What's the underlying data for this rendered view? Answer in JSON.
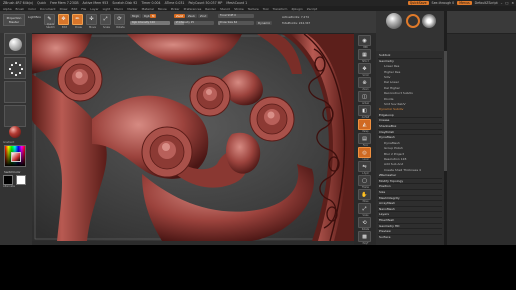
{
  "titlebar": {
    "segments": [
      "ZBrush 4R7 64b(x)",
      "Quick",
      "Free Mem 7.23GB",
      "Active Mem 953",
      "Scratch Disk 92",
      "Timer 0.004",
      "ATime 0.031",
      "PolyCount 50.037 MP",
      "MeshCount 1"
    ],
    "quicksave": "QuickSave",
    "see_through": "See-through 0",
    "menus": "Menus",
    "default_script": "DefaultZScript"
  },
  "menubar": {
    "items": [
      "Alpha",
      "Brush",
      "Color",
      "Document",
      "Draw",
      "Edit",
      "File",
      "Layer",
      "Light",
      "Macro",
      "Marker",
      "Material",
      "Movie",
      "Picker",
      "Preferences",
      "Render",
      "Stencil",
      "Stroke",
      "Texture",
      "Tool",
      "Transform",
      "Zplugin",
      "Zscript"
    ]
  },
  "shelf": {
    "projection_master": "Projection Master",
    "lightbox": "LightBox",
    "tools": [
      "Quick Sketch",
      "Edit",
      "Draw",
      "Move",
      "Scale",
      "Rotate"
    ],
    "mrgb": "Mrgb",
    "rgb": "Rgb",
    "m": "M",
    "zadd": "Zadd",
    "zsub": "Zsub",
    "zcut": "Zcut",
    "rgb_intensity": "Rgb Intensity 100",
    "z_intensity": "Z Intensity 25",
    "focal_shift": "Focal Shift 0",
    "draw_size": "Draw Size 64",
    "dynamic": "Dynamic",
    "active_points": "ActivePoints: 7,274",
    "total_points": "TotalPoints: 244,347",
    "rgb_intensity_fraction": 1.0,
    "z_intensity_fraction": 0.25,
    "draw_size_fraction": 0.06
  },
  "lefttray": {
    "switch_color": "SwitchColor",
    "gradient": "Gradient",
    "alternate": "Alternate"
  },
  "rightdock": {
    "buttons": [
      "BPR",
      "SPix 3",
      "Scroll",
      "Zoom",
      "Actual",
      "AAHalf",
      "Persp",
      "Floor",
      "Local",
      "L.Sym",
      "Frame",
      "Move",
      "Scale",
      "Rotate",
      "PolyF",
      "Transp",
      "Ghost",
      "Solo",
      "Xpose"
    ]
  },
  "rightpanel": {
    "rows": [
      {
        "type": "head",
        "text": "Subtool"
      },
      {
        "type": "head",
        "text": "Geometry"
      },
      {
        "type": "sub",
        "text": "Lower Res"
      },
      {
        "type": "sub",
        "text": "Higher Res"
      },
      {
        "type": "sub",
        "text": "Sdiv"
      },
      {
        "type": "sub",
        "text": "Del Lower"
      },
      {
        "type": "sub",
        "text": "Del Higher"
      },
      {
        "type": "sub",
        "text": "Reconstruct Subdiv"
      },
      {
        "type": "sub",
        "text": "Divide"
      },
      {
        "type": "sub",
        "text": "Smt  Suv  ReUV"
      },
      {
        "type": "orange",
        "text": "Dynamic Subdiv"
      },
      {
        "type": "head",
        "text": "EdgeLoop"
      },
      {
        "type": "head",
        "text": "Crease"
      },
      {
        "type": "head",
        "text": "ShadowBox"
      },
      {
        "type": "head",
        "text": "ClayPolish"
      },
      {
        "type": "head",
        "text": "DynaMesh"
      },
      {
        "type": "sub",
        "text": "DynaMesh"
      },
      {
        "type": "sub",
        "text": "Group  Polish"
      },
      {
        "type": "sub",
        "text": "Blur 2  Project"
      },
      {
        "type": "sub",
        "text": "Resolution 128"
      },
      {
        "type": "sub",
        "text": "Add  Sub  And"
      },
      {
        "type": "sub",
        "text": "Create Shell  Thickness 4"
      },
      {
        "type": "head",
        "text": "ZRemesher"
      },
      {
        "type": "head",
        "text": "Modify Topology"
      },
      {
        "type": "head",
        "text": "Position"
      },
      {
        "type": "head",
        "text": "Size"
      },
      {
        "type": "head",
        "text": "MeshIntegrity"
      },
      {
        "type": "head",
        "text": "ArrayMesh"
      },
      {
        "type": "head",
        "text": "NanoMesh"
      },
      {
        "type": "head",
        "text": "Layers"
      },
      {
        "type": "head",
        "text": "FiberMesh"
      },
      {
        "type": "head",
        "text": "Geometry HD"
      },
      {
        "type": "head",
        "text": "Preview"
      },
      {
        "type": "head",
        "text": "Surface"
      }
    ]
  }
}
